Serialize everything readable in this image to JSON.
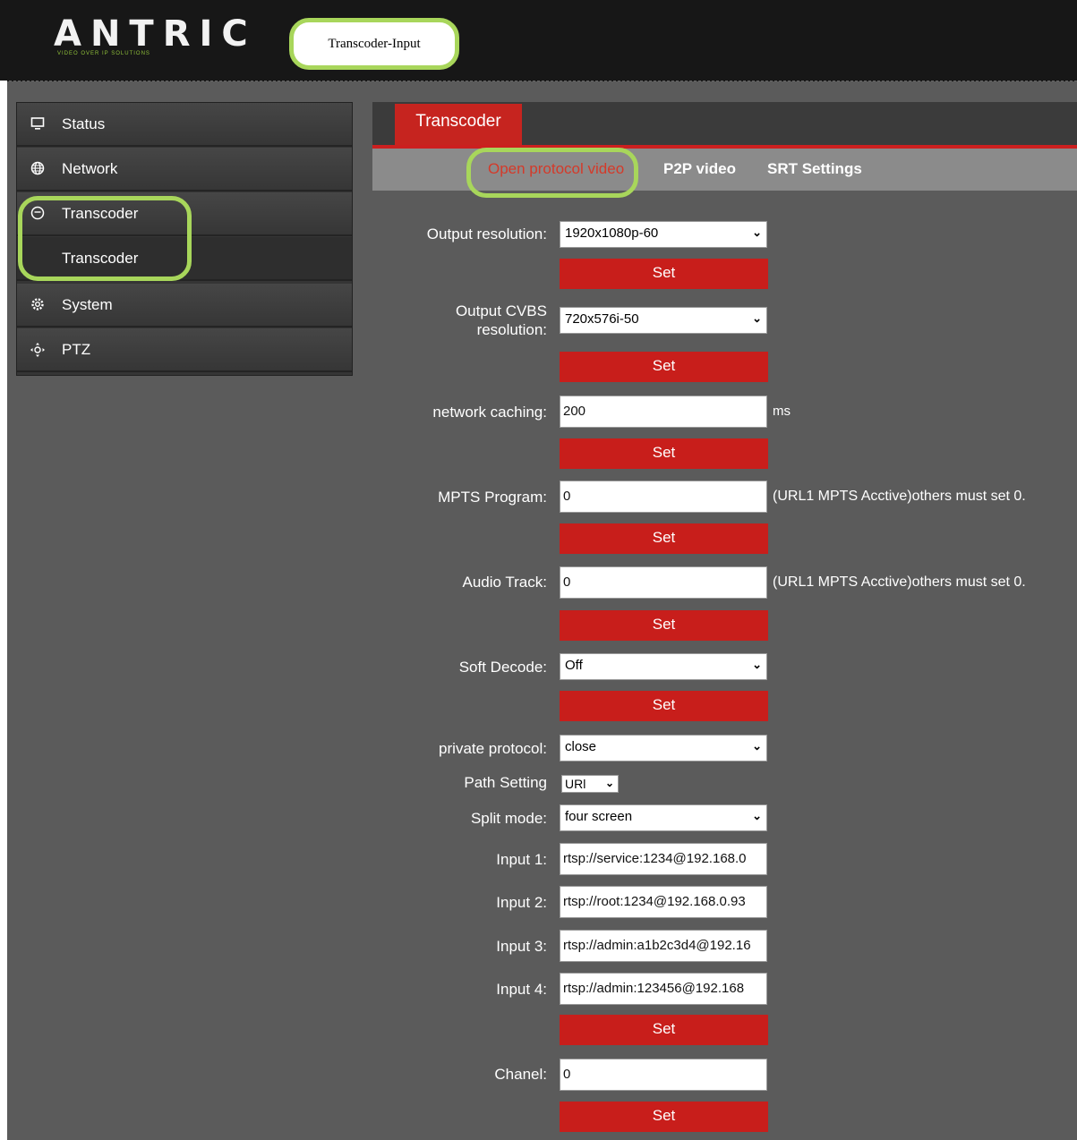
{
  "header": {
    "logo_text": "ANTRIC",
    "logo_tagline": "VIDEO OVER IP SOLUTIONS",
    "page_title": "Transcoder-Input"
  },
  "sidebar": {
    "items": [
      {
        "label": "Status",
        "icon": "monitor-icon"
      },
      {
        "label": "Network",
        "icon": "globe-icon"
      },
      {
        "label": "Transcoder",
        "icon": "transcoder-icon"
      },
      {
        "label": "Transcoder",
        "icon": ""
      },
      {
        "label": "System",
        "icon": "gear-icon"
      },
      {
        "label": "PTZ",
        "icon": "ptz-icon"
      }
    ]
  },
  "tabs": {
    "main": "Transcoder",
    "sub": [
      "Open protocol video",
      "P2P video",
      "SRT Settings"
    ]
  },
  "form": {
    "output_resolution": {
      "label": "Output resolution:",
      "value": "1920x1080p-60"
    },
    "cvbs_resolution": {
      "label_line1": "Output CVBS",
      "label_line2": "resolution:",
      "value": "720x576i-50"
    },
    "network_caching": {
      "label": "network caching:",
      "value": "200",
      "unit": "ms"
    },
    "mpts_program": {
      "label": "MPTS Program:",
      "value": "0",
      "note": "(URL1 MPTS Acctive)others must set 0."
    },
    "audio_track": {
      "label": "Audio Track:",
      "value": "0",
      "note": "(URL1 MPTS Acctive)others must set 0."
    },
    "soft_decode": {
      "label": "Soft Decode:",
      "value": "Off"
    },
    "private_protocol": {
      "label": "private protocol:",
      "value": "close"
    },
    "path_setting": {
      "label": "Path Setting",
      "value": "URl"
    },
    "split_mode": {
      "label": "Split mode:",
      "value": "four screen"
    },
    "inputs": [
      {
        "label": "Input 1:",
        "value": "rtsp://service:1234@192.168.0"
      },
      {
        "label": "Input 2:",
        "value": "rtsp://root:1234@192.168.0.93"
      },
      {
        "label": "Input 3:",
        "value": "rtsp://admin:a1b2c3d4@192.16"
      },
      {
        "label": "Input 4:",
        "value": "rtsp://admin:123456@192.168"
      }
    ],
    "chanel": {
      "label": "Chanel:",
      "value": "0"
    },
    "set_label": "Set"
  },
  "colors": {
    "accent_red": "#c81e1b",
    "highlight_green": "#a8d65b",
    "background": "#5b5b5b"
  }
}
